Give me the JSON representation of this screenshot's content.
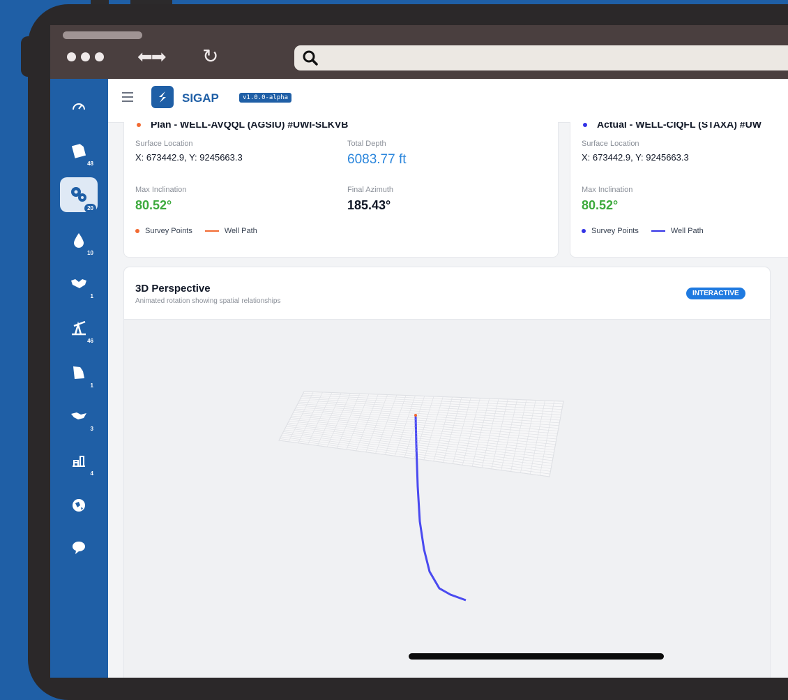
{
  "app": {
    "title": "SIGAP",
    "version": "v1.0.0-alpha"
  },
  "sidebar": {
    "items": [
      {
        "icon": "gauge-icon",
        "badge": ""
      },
      {
        "icon": "document-icon",
        "badge": "48"
      },
      {
        "icon": "gears-icon",
        "badge": "20",
        "active": true
      },
      {
        "icon": "drop-icon",
        "badge": "10"
      },
      {
        "icon": "handshake-icon",
        "badge": "1"
      },
      {
        "icon": "oil-pump-icon",
        "badge": "46"
      },
      {
        "icon": "map-region-icon",
        "badge": "1"
      },
      {
        "icon": "island-icon",
        "badge": "3"
      },
      {
        "icon": "rig-icon",
        "badge": "4"
      },
      {
        "icon": "globe-icon",
        "badge": ""
      },
      {
        "icon": "chat-icon",
        "badge": ""
      }
    ]
  },
  "plan_card": {
    "title": "Plan - WELL-AVQQL (AGSIU) #UWI-SLKVB",
    "surface_location_label": "Surface Location",
    "surface_location_value": "X: 673442.9, Y: 9245663.3",
    "total_depth_label": "Total Depth",
    "total_depth_value": "6083.77 ft",
    "max_inclination_label": "Max Inclination",
    "max_inclination_value": "80.52°",
    "final_azimuth_label": "Final Azimuth",
    "final_azimuth_value": "185.43°",
    "legend_points": "Survey Points",
    "legend_path": "Well Path",
    "color": "#f26a32"
  },
  "actual_card": {
    "title": "Actual - WELL-CIQFL (STAXA) #UW",
    "surface_location_label": "Surface Location",
    "surface_location_value": "X: 673442.9, Y: 9245663.3",
    "max_inclination_label": "Max Inclination",
    "max_inclination_value": "80.52°",
    "legend_points": "Survey Points",
    "legend_path": "Well Path",
    "color": "#3333e6"
  },
  "perspective": {
    "title": "3D Perspective",
    "subtitle": "Animated rotation showing spatial relationships",
    "badge": "INTERACTIVE"
  },
  "colors": {
    "brand": "#1f5fa6",
    "depth_blue": "#2b86dc",
    "incl_green": "#3daa3d",
    "path": "#4a4af0"
  }
}
